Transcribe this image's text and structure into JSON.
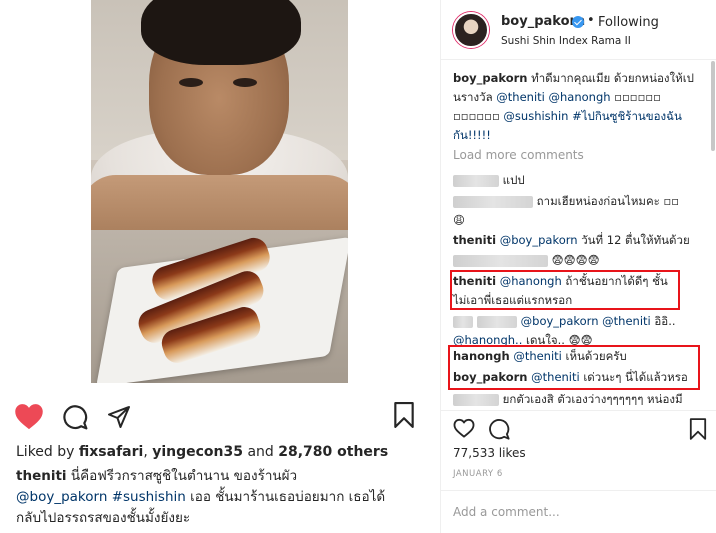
{
  "left": {
    "likes": {
      "prefix": "Liked by ",
      "user1": "fixsafari",
      "sep": ", ",
      "user2": "yingecon35",
      "and": " and ",
      "count": "28,780 others"
    },
    "caption": {
      "user": "theniti",
      "text1": " นี่คือฟรีวกราสซูชิในตำนาน ของร้านผัว",
      "mention": "@boy_pakorn",
      "hashtag": "#sushishin",
      "text2": " เออ ชั้นมาร้านเธอบ่อยมาก เธอได้กลับไปอรรถรสของชั้นมั้งยังยะ"
    }
  },
  "header": {
    "username": "boy_pakorn",
    "dot": "•",
    "following": "Following",
    "location": "Sushi Shin Index Rama II"
  },
  "comments": {
    "caption": {
      "user": "boy_pakorn",
      "text1": " ทำดีมากคุณเมีย ด้วยกหน่องให้เปนรางวัล ",
      "m1": "@theniti",
      "m2": "@hanongh",
      "boxes1": " ▫▫▫▫▫▫ ▫▫▫▫▫▫ ",
      "m3": "@sushishin",
      "tag": "#ไปกินซูชิร้านของฉันกัน!!!!!"
    },
    "load_more": "Load more comments",
    "c1": {
      "text": " แปป"
    },
    "c2": {
      "text": " ถามเฮียหน่องก่อนไหมคะ ▫▫",
      "emoji": "😩"
    },
    "c3": {
      "user": "theniti",
      "mention": "@boy_pakorn",
      "text": " วันที่ 12 ตื่นให้ทันด้วย"
    },
    "c4": {
      "emoji": "😨😨😨😨"
    },
    "c5": {
      "user": "theniti",
      "mention": "@hanongh",
      "text": " ถ้าชั้นอยากได้ดีๆ ชั้นไม่เอาพี่เธอแต่แรกหรอก"
    },
    "c6": {
      "m1": "@boy_pakorn",
      "m2": "@theniti",
      "text1": " อิอิ..",
      "m3": "@hanongh..",
      "text2": " เดนใจ.. 😨😨"
    },
    "c7": {
      "user": "hanongh",
      "mention": "@theniti",
      "text": " เห็นด้วยครับ"
    },
    "c8": {
      "user": "boy_pakorn",
      "mention": "@theniti",
      "text": " เด่วนะๆ นี่ได้แล้วหรอ"
    },
    "c9": {
      "text": " ยกตัวเองสิ ตัวเองว่างๆๆๆๆๆๆ หน่องมี"
    }
  },
  "footer": {
    "likes": "77,533 likes",
    "date": "JANUARY 6",
    "add_comment_placeholder": "Add a comment..."
  },
  "colors": {
    "heart": "#ed4956",
    "mention": "#003569",
    "highlight": "#e8141a",
    "verified": "#3897f0"
  },
  "icons": [
    "heart-icon",
    "comment-icon",
    "share-icon",
    "bookmark-icon",
    "verified-badge-icon"
  ]
}
